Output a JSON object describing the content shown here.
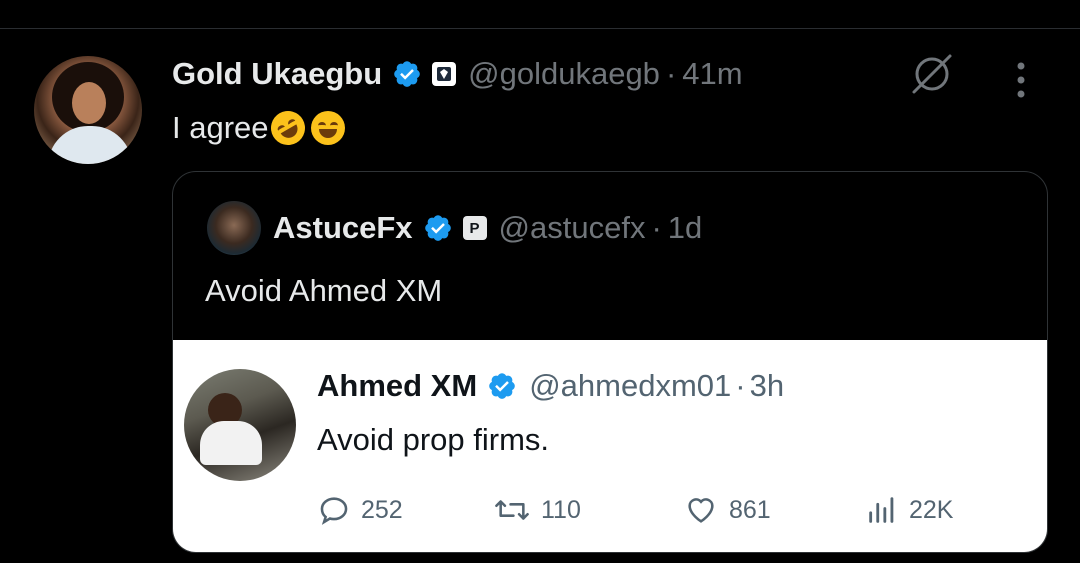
{
  "tweet": {
    "author_name": "Gold Ukaegbu",
    "handle": "@goldukaegb",
    "separator": "·",
    "time": "41m",
    "text": "I agree",
    "emojis": [
      "rolling-on-floor-laughing",
      "grinning-squinting-face"
    ]
  },
  "quote": {
    "author_name": "AstuceFx",
    "affiliate_badge": "P",
    "handle": "@astucefx",
    "separator": "·",
    "time": "1d",
    "text": "Avoid Ahmed XM"
  },
  "inner_tweet": {
    "author_name": "Ahmed XM",
    "handle": "@ahmedxm01",
    "separator": "·",
    "time": "3h",
    "text": "Avoid prop firms.",
    "replies": "252",
    "retweets": "110",
    "likes": "861",
    "views": "22K"
  },
  "colors": {
    "verified": "#1d9bf0",
    "background": "#000000",
    "muted": "#71767b"
  }
}
